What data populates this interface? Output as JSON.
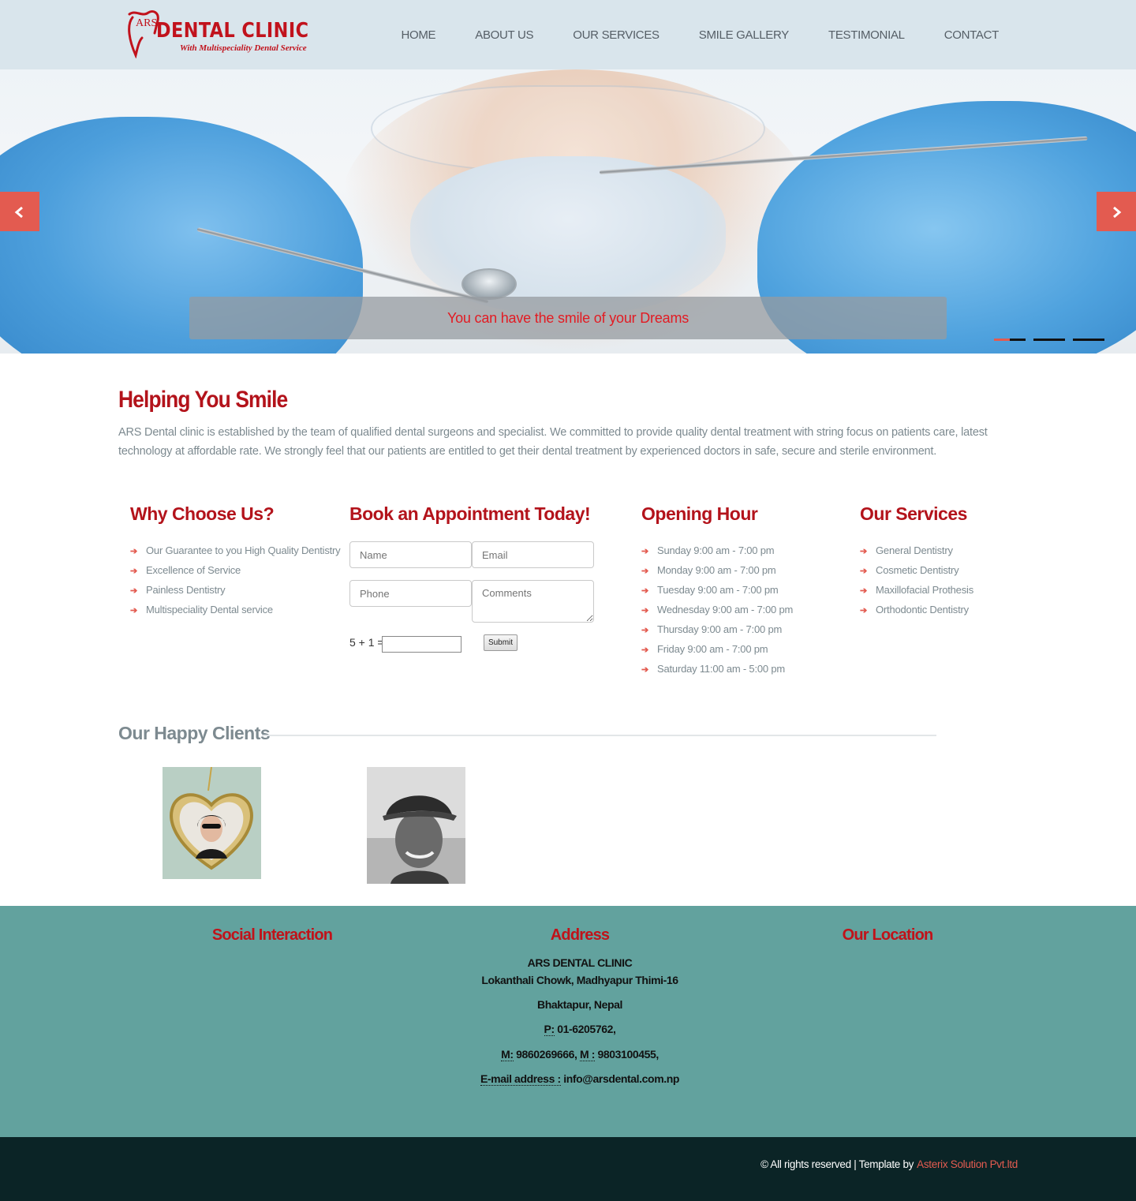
{
  "logo": {
    "prefix": "ARS",
    "title": "DENTAL CLINIC",
    "subtitle": "With Multispeciality Dental Service"
  },
  "nav": {
    "items": [
      "HOME",
      "ABOUT US",
      "OUR SERVICES",
      "SMILE GALLERY",
      "TESTIMONIAL",
      "CONTACT"
    ]
  },
  "hero": {
    "caption": "You can have the smile of your Dreams",
    "prev_label": "‹",
    "next_label": "›",
    "slide_count": 3,
    "active_slide": 1
  },
  "intro": {
    "title": "Helping You Smile",
    "text": "ARS Dental clinic is established by the team of qualified dental surgeons and specialist. We committed to provide quality dental treatment with string focus on patients care, latest technology at affordable rate. We strongly feel that our patients are entitled to get their dental treatment by experienced doctors in safe, secure and sterile environment."
  },
  "why": {
    "title": "Why Choose Us?",
    "items": [
      "Our Guarantee to you High Quality Dentistry",
      "Excellence of Service",
      "Painless Dentistry",
      "Multispeciality Dental service"
    ]
  },
  "appointment": {
    "title": "Book an Appointment Today!",
    "name_placeholder": "Name",
    "email_placeholder": "Email",
    "phone_placeholder": "Phone",
    "comments_placeholder": "Comments",
    "captcha_label": "5 + 1 =",
    "submit_label": "Submit"
  },
  "hours": {
    "title": "Opening Hour",
    "items": [
      "Sunday 9:00 am - 7:00 pm",
      "Monday 9:00 am - 7:00 pm",
      "Tuesday 9:00 am - 7:00 pm",
      "Wednesday 9:00 am - 7:00 pm",
      "Thursday 9:00 am - 7:00 pm",
      "Friday 9:00 am - 7:00 pm",
      "Saturday 11:00 am - 5:00 pm"
    ]
  },
  "services": {
    "title": "Our Services",
    "items": [
      "General Dentistry",
      "Cosmetic Dentistry",
      "Maxillofacial Prothesis",
      "Orthodontic Dentistry"
    ]
  },
  "clients": {
    "title": "Our Happy Clients"
  },
  "footer": {
    "social_title": "Social Interaction",
    "address_title": "Address",
    "location_title": "Our Location",
    "clinic_name": "ARS DENTAL CLINIC",
    "street": "Lokanthali Chowk, Madhyapur Thimi-16",
    "city": "Bhaktapur, Nepal",
    "phone_label": "P:",
    "phone": "01-6205762,",
    "mobile_label": "M:",
    "mobile1": "9860269666,",
    "mobile_label2": "M :",
    "mobile2": "9803100455,",
    "email_label": "E-mail address :",
    "email": "info@arsdental.com.np"
  },
  "bottom": {
    "copyright": "© All rights reserved | Template by",
    "author": "Asterix Solution Pvt.ltd"
  },
  "colors": {
    "brand_red": "#c1121c",
    "accent": "#e35b50",
    "header_bg": "#d9e5ec",
    "footer_bg": "#62a29e",
    "bottom_bg": "#0b2426"
  }
}
